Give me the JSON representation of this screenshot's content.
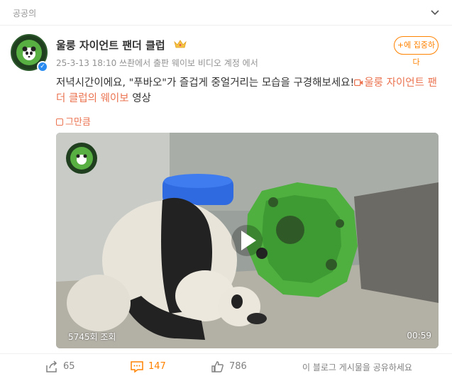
{
  "topbar": {
    "label": "공공의"
  },
  "post": {
    "username": "울룽 자이언트 팬더 클럽",
    "meta": "25-3-13 18:10  쓰촨에서 출판 웨이보 비디오 계정 에서",
    "follow_label": "+에 집중하다",
    "text_main": "저녁시간이에요, \"푸바오\"가 즐겁게 중얼거리는 모습을 구경해보세요!",
    "text_link": "울룽 자이언트 팬더 클럽의 웨이보",
    "text_tail": " 영상",
    "collapse_label": "그만큼"
  },
  "video": {
    "views": "5745회 조회",
    "duration": "00:59"
  },
  "actions": {
    "share_count": "65",
    "comment_count": "147",
    "like_count": "786",
    "share_note": "이 블로그 게시물을 공유하세요"
  },
  "colors": {
    "accent": "#ff8200",
    "link": "#eb7350",
    "muted": "#939393"
  }
}
